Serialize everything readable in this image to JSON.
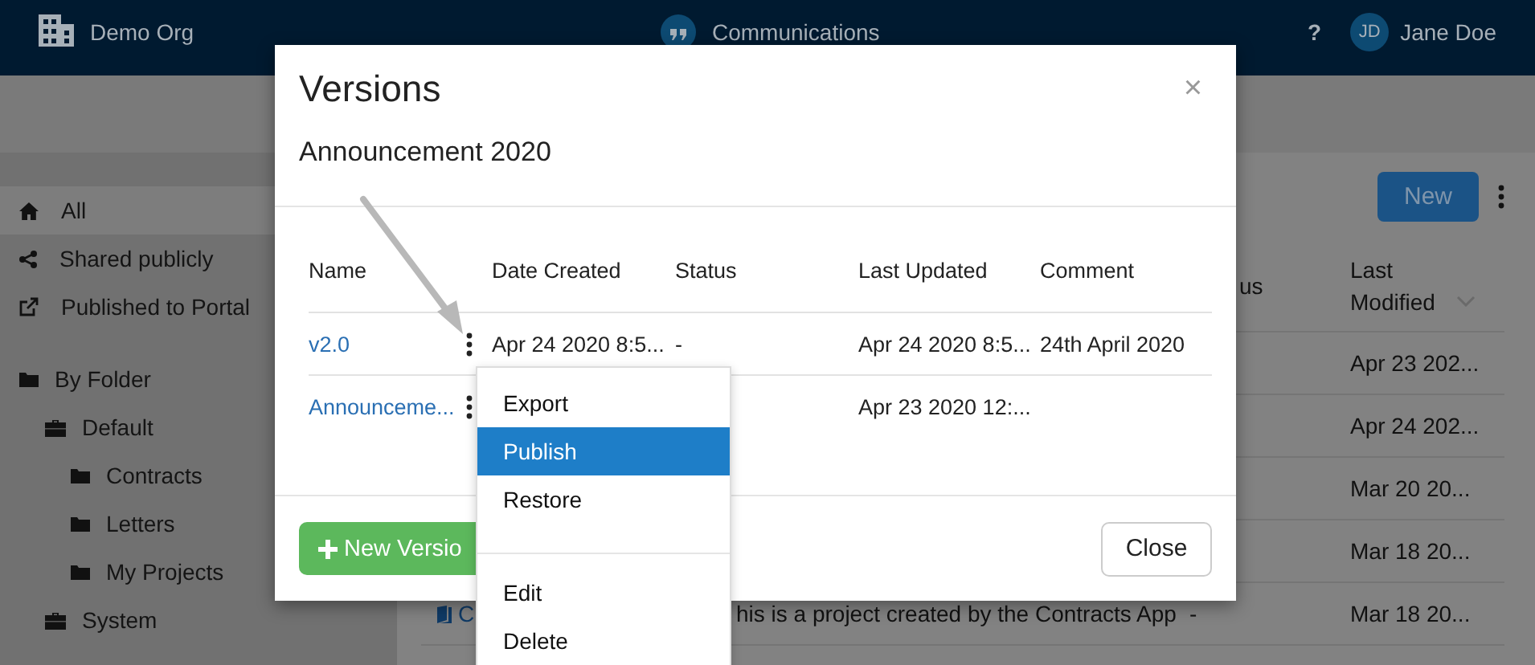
{
  "topbar": {
    "org": "Demo Org",
    "app": "Communications",
    "help": "?",
    "avatar": "JD",
    "user": "Jane Doe"
  },
  "sidebar": {
    "nav": [
      {
        "label": "All",
        "kind": "home",
        "selected": true
      },
      {
        "label": "Shared publicly",
        "kind": "share",
        "selected": false
      },
      {
        "label": "Published to Portal",
        "kind": "publish",
        "selected": false
      }
    ],
    "tree": [
      {
        "label": "By Folder",
        "kind": "folder",
        "children": [
          {
            "label": "Default",
            "kind": "group",
            "children": [
              {
                "label": "Contracts",
                "kind": "folder"
              },
              {
                "label": "Letters",
                "kind": "folder"
              },
              {
                "label": "My Projects",
                "kind": "folder"
              }
            ]
          },
          {
            "label": "System",
            "kind": "group"
          }
        ]
      }
    ]
  },
  "main": {
    "new_button": "New",
    "columns": {
      "column_4": "us",
      "last_modified": "Last Modified"
    },
    "rows": [
      {
        "last_modified": "Apr 23 202..."
      },
      {
        "last_modified": "Apr 24 202..."
      },
      {
        "last_modified": "Mar 20 20..."
      },
      {
        "last_modified": "Mar 18 20..."
      },
      {
        "name": "C",
        "description": "his is a project created by the Contracts App",
        "column_3": "-",
        "last_modified": "Mar 18 20..."
      }
    ]
  },
  "modal": {
    "title": "Versions",
    "subtitle": "Announcement 2020",
    "close_icon": "×",
    "columns": [
      "Name",
      "Date Created",
      "Status",
      "Last Updated",
      "Comment"
    ],
    "rows": [
      {
        "name": "v2.0",
        "date_created": "Apr 24 2020 8:5...",
        "status": "-",
        "last_updated": "Apr 24 2020 8:5...",
        "comment": "24th April 2020"
      },
      {
        "name": "Announceme...",
        "last_updated": "Apr 23 2020 12:..."
      }
    ],
    "new_version": "New Versio",
    "close": "Close"
  },
  "menu": {
    "groups": [
      [
        {
          "label": "Export",
          "selected": false
        },
        {
          "label": "Publish",
          "selected": true
        },
        {
          "label": "Restore",
          "selected": false
        }
      ],
      [
        {
          "label": "Edit",
          "selected": false
        },
        {
          "label": "Delete",
          "selected": false
        }
      ]
    ]
  }
}
